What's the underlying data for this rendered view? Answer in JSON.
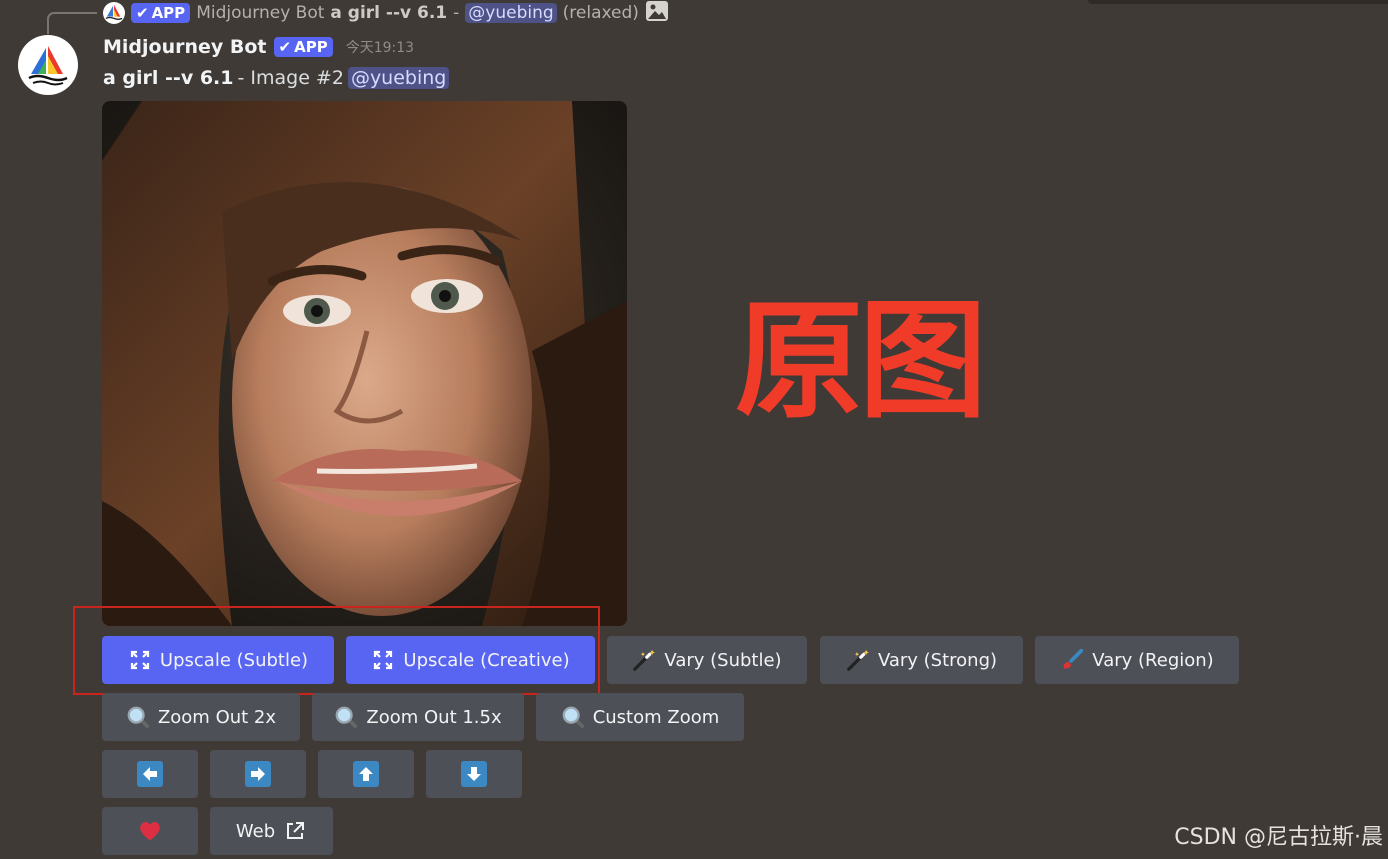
{
  "reply": {
    "bot_name": "Midjourney Bot",
    "app_badge": "APP",
    "prompt": "a girl --v 6.1",
    "separator": "-",
    "mention": "@yuebing",
    "mode": "(relaxed)"
  },
  "message": {
    "author": "Midjourney Bot",
    "app_badge": "APP",
    "timestamp": "今天19:13",
    "prompt": "a girl --v 6.1",
    "image_label": " - Image #2",
    "mention": "@yuebing"
  },
  "annotation": {
    "text": "原图",
    "color": "#ef3b28"
  },
  "buttons": {
    "row1": [
      {
        "label": "Upscale (Subtle)",
        "icon": "expand-icon",
        "style": "primary"
      },
      {
        "label": "Upscale (Creative)",
        "icon": "expand-icon",
        "style": "primary"
      },
      {
        "label": "Vary (Subtle)",
        "icon": "magic-wand-icon",
        "style": "secondary"
      },
      {
        "label": "Vary (Strong)",
        "icon": "magic-wand-icon",
        "style": "secondary"
      },
      {
        "label": "Vary (Region)",
        "icon": "paintbrush-icon",
        "style": "secondary"
      }
    ],
    "row2": [
      {
        "label": "Zoom Out 2x",
        "icon": "magnifier-icon"
      },
      {
        "label": "Zoom Out 1.5x",
        "icon": "magnifier-icon"
      },
      {
        "label": "Custom Zoom",
        "icon": "magnifier-icon"
      }
    ],
    "row3": [
      {
        "icon": "arrow-left-icon"
      },
      {
        "icon": "arrow-right-icon"
      },
      {
        "icon": "arrow-up-icon"
      },
      {
        "icon": "arrow-down-icon"
      }
    ],
    "row4": [
      {
        "icon": "heart-icon"
      },
      {
        "label": "Web",
        "icon": "external-link-icon"
      }
    ]
  },
  "colors": {
    "background": "#3f3a36",
    "primary_button": "#5865f2",
    "secondary_button": "#4e5058",
    "mention_bg": "#4e5287",
    "highlight_box": "#c8251e"
  },
  "watermark": "CSDN @尼古拉斯·晨"
}
